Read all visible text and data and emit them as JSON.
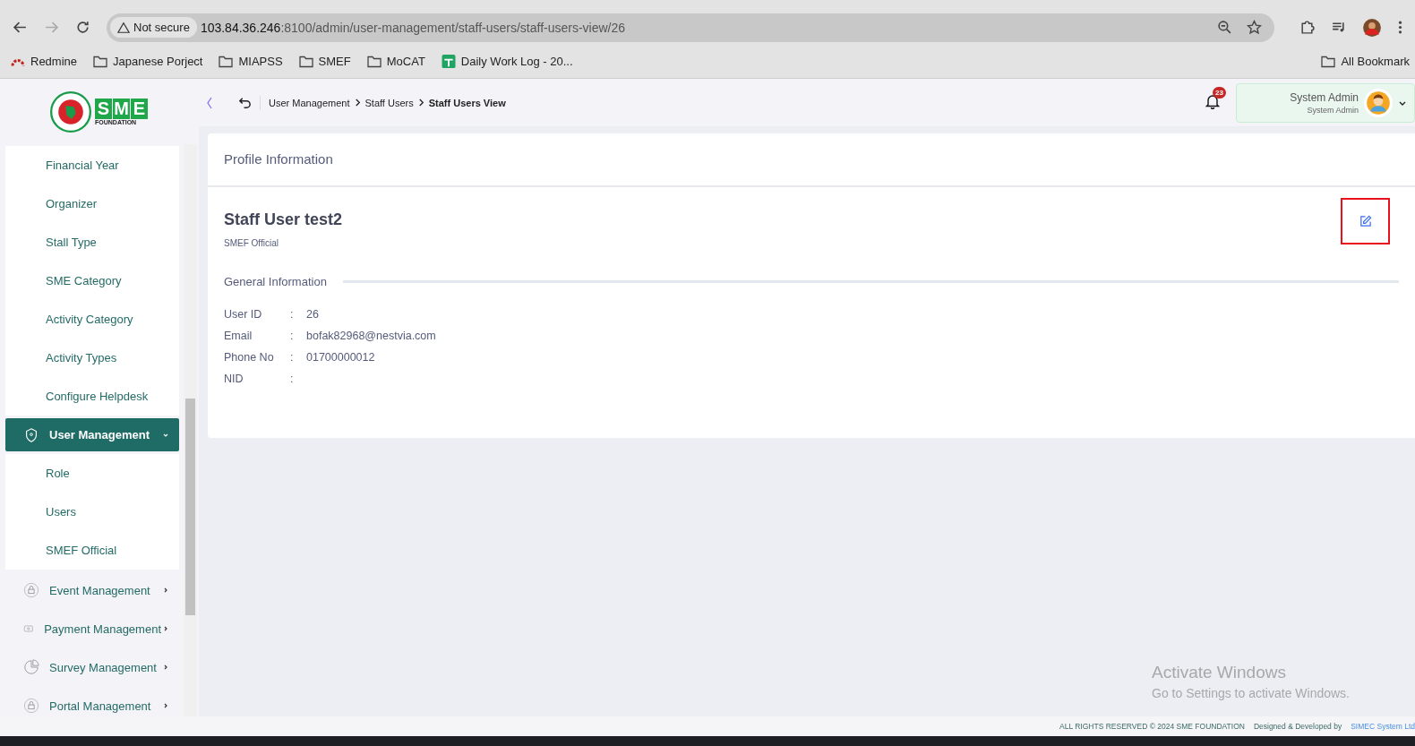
{
  "browser": {
    "security": "Not secure",
    "url_host": "103.84.36.246",
    "url_path": ":8100/admin/user-management/staff-users/staff-users-view/26",
    "bookmarks": [
      {
        "label": "Redmine",
        "kind": "redmine"
      },
      {
        "label": "Japanese Porject",
        "kind": "folder"
      },
      {
        "label": "MIAPSS",
        "kind": "folder"
      },
      {
        "label": "SMEF",
        "kind": "folder"
      },
      {
        "label": "MoCAT",
        "kind": "folder"
      },
      {
        "label": "Daily Work Log - 20...",
        "kind": "sheet"
      }
    ],
    "all_bookmarks": "All Bookmark"
  },
  "logo": {
    "letters": [
      "S",
      "M",
      "E"
    ],
    "caption": "FOUNDATION"
  },
  "header": {
    "breadcrumb": [
      {
        "label": "User Management",
        "current": false
      },
      {
        "label": "Staff Users",
        "current": false
      },
      {
        "label": "Staff Users View",
        "current": true
      }
    ],
    "notification_count": "23",
    "user_name": "System Admin",
    "user_role": "System Admin"
  },
  "sidebar": {
    "items": [
      {
        "label": "Financial Year"
      },
      {
        "label": "Organizer"
      },
      {
        "label": "Stall Type"
      },
      {
        "label": "SME Category"
      },
      {
        "label": "Activity Category"
      },
      {
        "label": "Activity Types"
      },
      {
        "label": "Configure Helpdesk"
      }
    ],
    "groups": [
      {
        "label": "User Management",
        "kind": "shield",
        "selected": true,
        "expanded": true,
        "children": [
          {
            "label": "Role"
          },
          {
            "label": "Users"
          },
          {
            "label": "SMEF Official"
          }
        ]
      },
      {
        "label": "Event Management",
        "kind": "lock",
        "selected": false,
        "expanded": false
      },
      {
        "label": "Payment Management",
        "kind": "money",
        "selected": false,
        "expanded": false
      },
      {
        "label": "Survey Management",
        "kind": "pie",
        "selected": false,
        "expanded": false
      },
      {
        "label": "Portal Management",
        "kind": "lock",
        "selected": false,
        "expanded": false
      }
    ]
  },
  "profile": {
    "title": "Profile Information",
    "name": "Staff User test2",
    "role": "SMEF Official",
    "highlighted_edit": true,
    "section_title": "General Information",
    "fields": [
      {
        "label": "User ID",
        "separator": ":",
        "value": "26"
      },
      {
        "label": "Email",
        "separator": ":",
        "value": "bofak82968@nestvia.com"
      },
      {
        "label": "Phone No",
        "separator": ":",
        "value": "01700000012"
      },
      {
        "label": "NID",
        "separator": ":"
      }
    ]
  },
  "os_overlay": {
    "title": "Activate Windows",
    "subtitle": "Go to Settings to activate Windows."
  },
  "footer": {
    "rights": "ALL RIGHTS RESERVED © 2024 SME FOUNDATION",
    "designed": "Designed & Developed by",
    "developer": "SIMEC System Ltd"
  }
}
